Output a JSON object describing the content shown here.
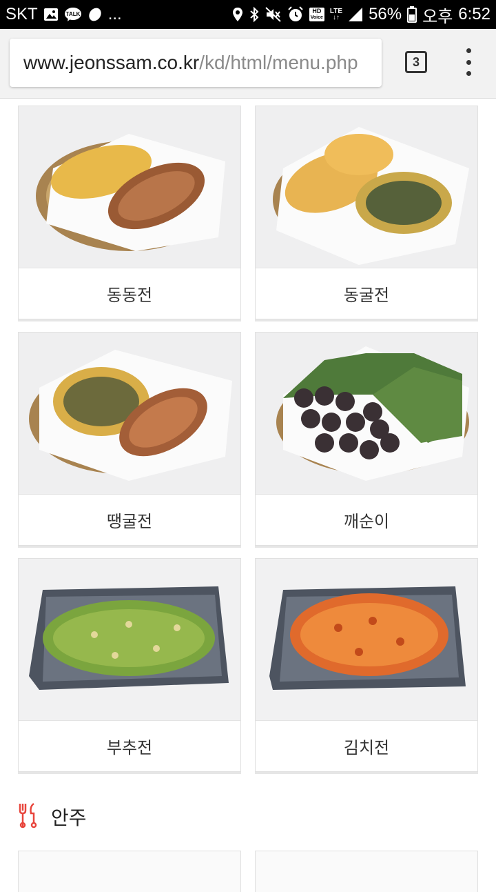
{
  "status_bar": {
    "carrier": "SKT",
    "ellipsis": "...",
    "talk_label": "TALK",
    "hd_label": "HD",
    "voice_label": "Voice",
    "lte_label": "LTE",
    "battery": "56%",
    "ampm": "오후",
    "time": "6:52"
  },
  "browser": {
    "url_host": "www.jeonssam.co.kr",
    "url_path": "/kd/html/menu.php",
    "tab_count": "3"
  },
  "menu_items": [
    {
      "name": "동동전"
    },
    {
      "name": "동굴전"
    },
    {
      "name": "땡굴전"
    },
    {
      "name": "깨순이"
    },
    {
      "name": "부추전"
    },
    {
      "name": "김치전"
    }
  ],
  "section": {
    "title": "안주"
  },
  "colors": {
    "accent_icon": "#e8453c",
    "status_bg": "#000000",
    "chrome_bg": "#f2f2f2"
  }
}
